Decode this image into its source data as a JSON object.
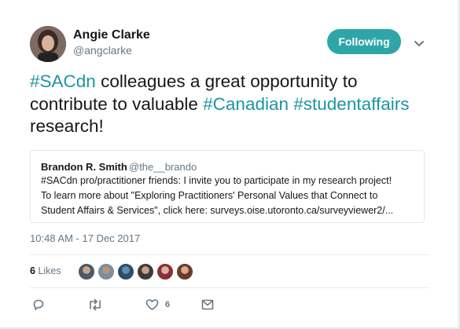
{
  "tweet": {
    "author_name": "Angie Clarke",
    "author_handle": "@angclarke",
    "follow_label": "Following",
    "text_parts": [
      "#SACdn",
      " colleagues a great opportunity to contribute to valuable ",
      "#Canadian",
      " ",
      "#studentaffairs",
      " research!"
    ],
    "timestamp": "10:48 AM - 17 Dec 2017",
    "likes_count": "6",
    "likes_label": "Likes",
    "like_action_count": "6"
  },
  "quote": {
    "author_name": "Brandon R. Smith",
    "author_handle": "@the__brando",
    "lines": [
      "#SACdn pro/practitioner friends: I invite you to participate in my research project!",
      "To learn more about \"Exploring Practitioners' Personal Values that Connect to",
      "Student Affairs & Services\", click here: surveys.oise.utoronto.ca/surveyviewer2/..."
    ]
  },
  "icons": {
    "caret": "chevron-down-icon",
    "reply": "reply-icon",
    "retweet": "retweet-icon",
    "like": "heart-icon",
    "message": "envelope-icon"
  },
  "colors": {
    "accent": "#2ea6a8",
    "hashtag": "#1b95a1",
    "secondary_text": "#657786",
    "action_icon": "#657786"
  }
}
